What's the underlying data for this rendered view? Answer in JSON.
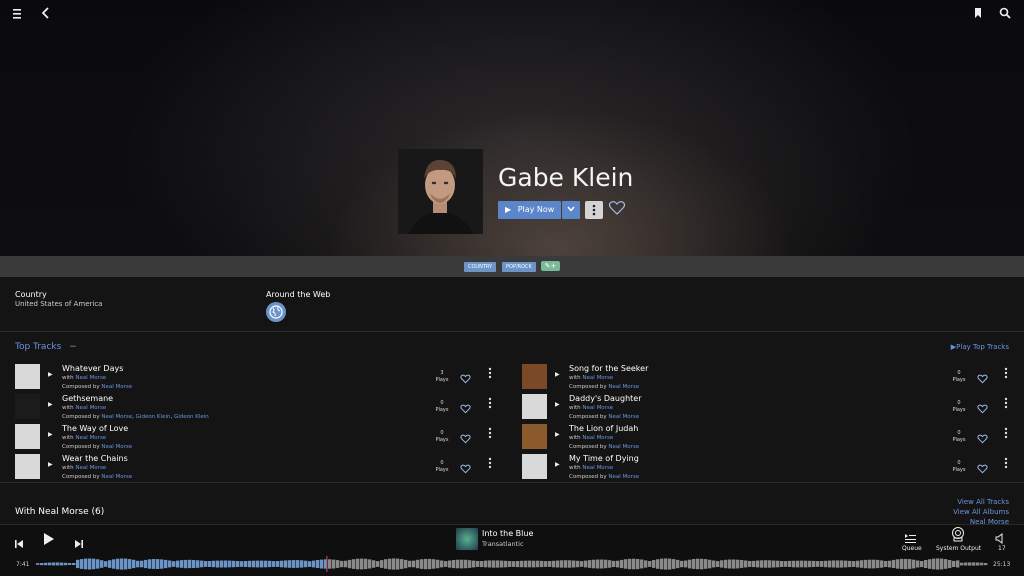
{
  "artist": {
    "name": "Gabe Klein",
    "play_now_label": "Play Now"
  },
  "genres": [
    "COUNTRY",
    "POP/ROCK"
  ],
  "info": {
    "country_label": "Country",
    "country_value": "United States of America",
    "web_label": "Around the Web"
  },
  "top_tracks": {
    "title": "Top Tracks",
    "collapse_symbol": "−",
    "play_label": "Play Top Tracks",
    "with_label": "with",
    "composed_label": "Composed by",
    "plays_label": "Plays",
    "left": [
      {
        "name": "Whatever Days",
        "with": "Neal Morse",
        "composers": [
          "Neal Morse"
        ],
        "plays": "3"
      },
      {
        "name": "Gethsemane",
        "with": "Neal Morse",
        "composers": [
          "Neal Morse",
          "Gideon Klein",
          "Gideon Klein"
        ],
        "plays": "0"
      },
      {
        "name": "The Way of Love",
        "with": "Neal Morse",
        "composers": [
          "Neal Morse"
        ],
        "plays": "0"
      },
      {
        "name": "Wear the Chains",
        "with": "Neal Morse",
        "composers": [
          "Neal Morse"
        ],
        "plays": "0"
      }
    ],
    "right": [
      {
        "name": "Song for the Seeker",
        "with": "Neal Morse",
        "composers": [
          "Neal Morse"
        ],
        "plays": "0"
      },
      {
        "name": "Daddy's Daughter",
        "with": "Neal Morse",
        "composers": [
          "Neal Morse"
        ],
        "plays": "0"
      },
      {
        "name": "The Lion of Judah",
        "with": "Neal Morse",
        "composers": [
          "Neal Morse"
        ],
        "plays": "0"
      },
      {
        "name": "My Time of Dying",
        "with": "Neal Morse",
        "composers": [
          "Neal Morse"
        ],
        "plays": "0"
      }
    ]
  },
  "with_section": {
    "title": "With Neal Morse (6)",
    "view_all_tracks": "View All Tracks",
    "view_all_albums": "View All Albums",
    "artist_link": "Neal Morse"
  },
  "player": {
    "track_title": "Into the Blue",
    "track_artist": "Transatlantic",
    "elapsed": "7:41",
    "duration": "25:13",
    "progress": 0.305,
    "queue_label": "Queue",
    "output_label": "System Output",
    "volume": "17"
  },
  "colors": {
    "accent": "#6b95e0",
    "button": "#5b86c9",
    "tag_edit": "#7ab89a"
  },
  "icons": [
    "menu-icon",
    "back-icon",
    "bookmark-icon",
    "search-icon",
    "play-icon",
    "chevron-down-icon",
    "more-vertical-icon",
    "heart-icon",
    "globe-icon",
    "previous-icon",
    "next-icon",
    "queue-icon",
    "speaker-icon",
    "volume-icon",
    "tag-edit-icon"
  ]
}
